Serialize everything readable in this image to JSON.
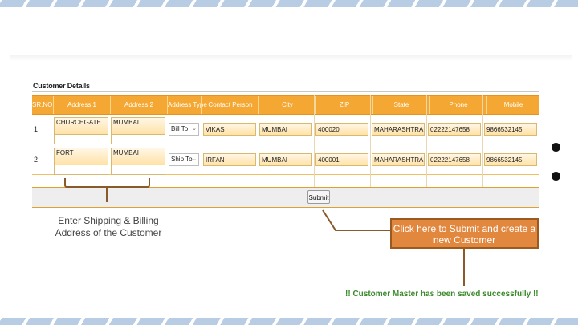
{
  "colors": {
    "header_orange": "#f4a833",
    "callout_orange": "#e2873e",
    "success_green": "#3a8a2a",
    "stripe_blue": "#b8cce4"
  },
  "panel": {
    "title": "Customer Details",
    "columns": [
      "SR.NO.",
      "Address 1",
      "Address 2",
      "Address Type",
      "Contact Person",
      "City",
      "ZIP",
      "State",
      "Phone",
      "Mobile"
    ],
    "rows": [
      {
        "sr": "1",
        "address1": "CHURCHGATE",
        "address2": "MUMBAI",
        "address_type": "Bill To",
        "contact": "VIKAS",
        "city": "MUMBAI",
        "zip": "400020",
        "state": "MAHARASHTRA",
        "phone": "02222147658",
        "mobile": "9866532145"
      },
      {
        "sr": "2",
        "address1": "FORT",
        "address2": "MUMBAI",
        "address_type": "Ship To",
        "contact": "IRFAN",
        "city": "MUMBAI",
        "zip": "400001",
        "state": "MAHARASHTRA",
        "phone": "02222147658",
        "mobile": "9866532145"
      }
    ],
    "submit_label": "Submit"
  },
  "annotations": {
    "left_note": "Enter Shipping & Billing Address of the Customer",
    "callout": "Click here to Submit and create a new Customer",
    "success": "!! Customer Master has been saved successfully !!"
  },
  "icons": [
    "chevron-down-icon",
    "bullet-icon"
  ]
}
